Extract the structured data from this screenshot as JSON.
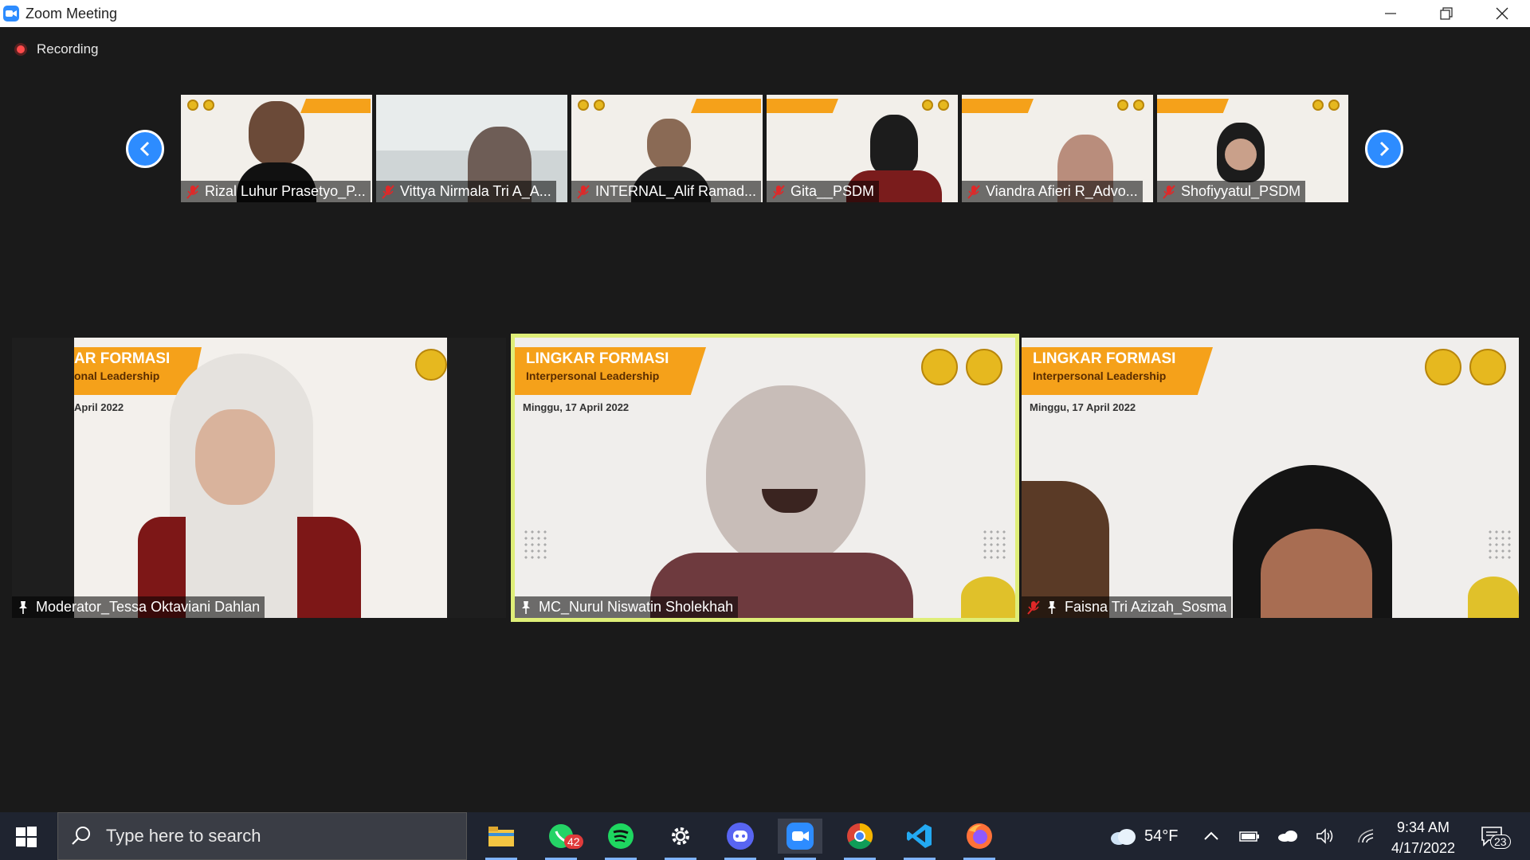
{
  "window": {
    "title": "Zoom Meeting"
  },
  "recording": {
    "label": "Recording"
  },
  "thumbnails": [
    {
      "name": "Rizal Luhur Prasetyo_P..."
    },
    {
      "name": "Vittya Nirmala Tri A_A..."
    },
    {
      "name": "INTERNAL_Alif Ramad..."
    },
    {
      "name": "Gita__PSDM"
    },
    {
      "name": "Viandra Afieri R_Advo..."
    },
    {
      "name": "Shofiyyatul_PSDM"
    }
  ],
  "banner": {
    "title": "LINGKAR FORMASI",
    "subtitle": "Interpersonal Leadership",
    "date": "Minggu, 17 April 2022"
  },
  "banner_cropped": {
    "title": "AR FORMASI",
    "subtitle": "onal Leadership",
    "date": "April 2022"
  },
  "main_tiles": [
    {
      "name": "Moderator_Tessa Oktaviani Dahlan"
    },
    {
      "name": "MC_Nurul Niswatin Sholekhah"
    },
    {
      "name": "Faisna Tri Azizah_Sosma"
    }
  ],
  "taskbar": {
    "search_placeholder": "Type here to search",
    "whatsapp_badge": "42",
    "weather": "54°F",
    "time": "9:34 AM",
    "date": "4/17/2022",
    "notifications": "23"
  },
  "colors": {
    "zoom_blue": "#2d8cff",
    "speaker_border": "#dfee78",
    "banner_orange": "#f5a11a",
    "recording_red": "#ff4b4b"
  }
}
